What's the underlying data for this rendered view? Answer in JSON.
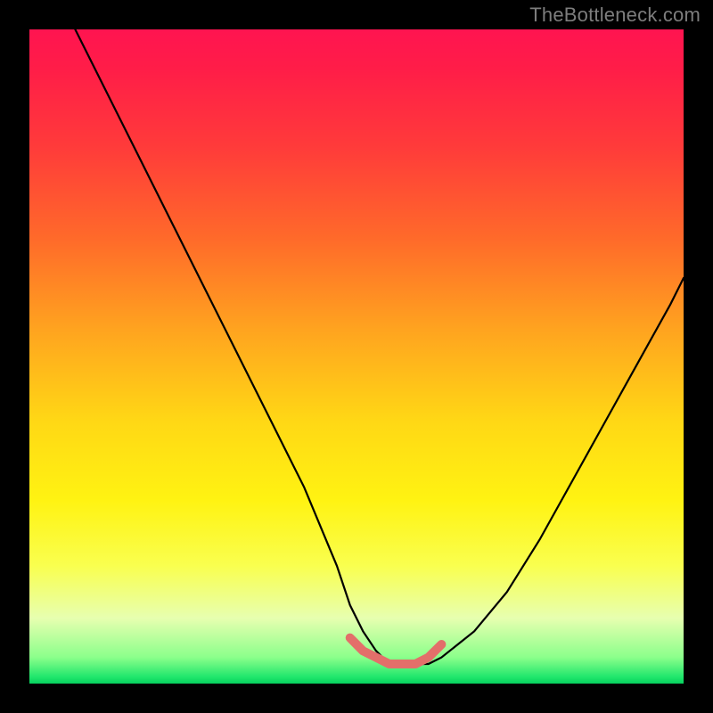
{
  "watermark": "TheBottleneck.com",
  "chart_data": {
    "type": "line",
    "title": "",
    "xlabel": "",
    "ylabel": "",
    "xlim": [
      0,
      100
    ],
    "ylim": [
      0,
      100
    ],
    "grid": false,
    "legend": false,
    "series": [
      {
        "name": "bottleneck-curve",
        "color": "#000000",
        "x": [
          7,
          12,
          17,
          22,
          27,
          32,
          37,
          42,
          47,
          49,
          51,
          53,
          55,
          57,
          59,
          61,
          63,
          68,
          73,
          78,
          83,
          88,
          93,
          98,
          100
        ],
        "y": [
          100,
          90,
          80,
          70,
          60,
          50,
          40,
          30,
          18,
          12,
          8,
          5,
          3,
          3,
          3,
          3,
          4,
          8,
          14,
          22,
          31,
          40,
          49,
          58,
          62
        ]
      },
      {
        "name": "optimal-range-marker",
        "color": "#e36f6a",
        "x": [
          49,
          51,
          53,
          55,
          57,
          59,
          61,
          63
        ],
        "y": [
          7,
          5,
          4,
          3,
          3,
          3,
          4,
          6
        ]
      }
    ],
    "gradient_stops": [
      {
        "pct": 0,
        "hex": "#ff1450"
      },
      {
        "pct": 6,
        "hex": "#ff1d48"
      },
      {
        "pct": 18,
        "hex": "#ff3b3a"
      },
      {
        "pct": 32,
        "hex": "#ff6a2a"
      },
      {
        "pct": 46,
        "hex": "#ffa41f"
      },
      {
        "pct": 60,
        "hex": "#ffd815"
      },
      {
        "pct": 72,
        "hex": "#fff312"
      },
      {
        "pct": 82,
        "hex": "#f9ff4f"
      },
      {
        "pct": 90,
        "hex": "#e7ffb0"
      },
      {
        "pct": 96,
        "hex": "#8bff8b"
      },
      {
        "pct": 99,
        "hex": "#20e66c"
      },
      {
        "pct": 100,
        "hex": "#07d15e"
      }
    ],
    "note": "Values are read off the image in percent of plot width/height; y=0 is the green bottom, y=100 is the red top."
  },
  "accent_colors": {
    "curve": "#000000",
    "marker": "#e36f6a",
    "watermark": "#7d7d7d",
    "frame": "#000000"
  }
}
